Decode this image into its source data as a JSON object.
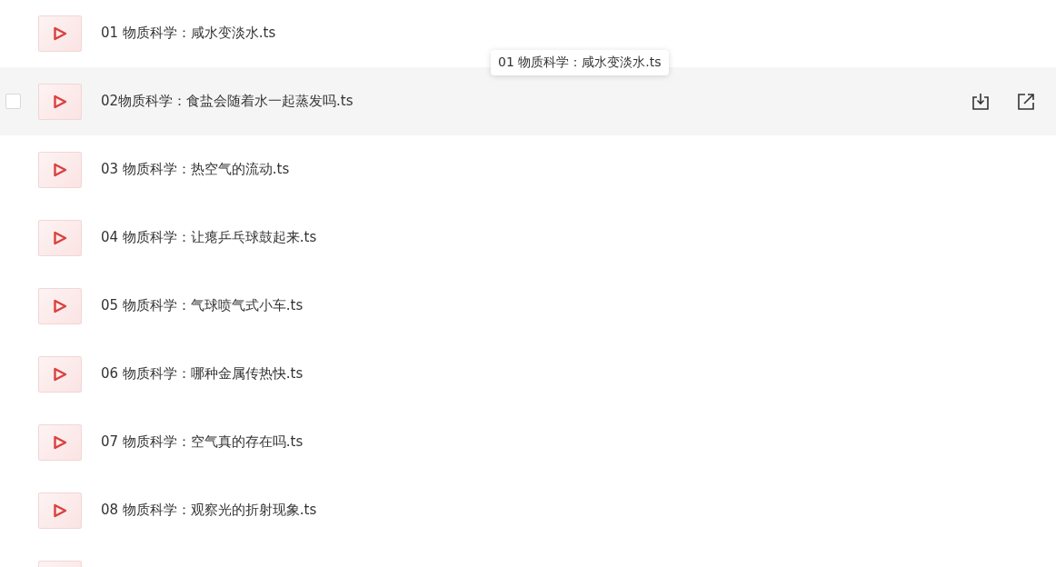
{
  "files": [
    {
      "title": "01 物质科学：咸水变淡水.ts",
      "hovered": false
    },
    {
      "title": "02物质科学：食盐会随着水一起蒸发吗.ts",
      "hovered": true,
      "checked": false
    },
    {
      "title": "03 物质科学：热空气的流动.ts",
      "hovered": false
    },
    {
      "title": "04 物质科学：让瘪乒乓球鼓起来.ts",
      "hovered": false
    },
    {
      "title": "05 物质科学：气球喷气式小车.ts",
      "hovered": false
    },
    {
      "title": "06 物质科学：哪种金属传热快.ts",
      "hovered": false
    },
    {
      "title": "07 物质科学：空气真的存在吗.ts",
      "hovered": false
    },
    {
      "title": "08 物质科学：观察光的折射现象.ts",
      "hovered": false
    }
  ],
  "tooltip": {
    "text": "01 物质科学：咸水变淡水.ts"
  }
}
